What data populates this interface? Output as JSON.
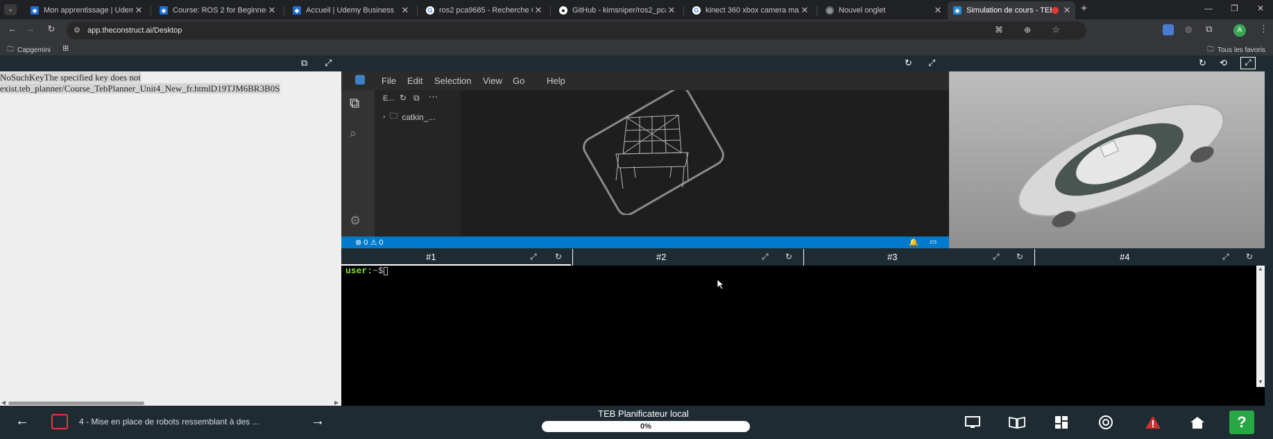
{
  "browser": {
    "tabs": [
      {
        "title": "Mon apprentissage | Udemy Bu",
        "favicon": "udemy"
      },
      {
        "title": "Course: ROS 2 for Beginners Le",
        "favicon": "udemy"
      },
      {
        "title": "Accueil | Udemy Business",
        "favicon": "udemy"
      },
      {
        "title": "ros2 pca9685 - Recherche Goo",
        "favicon": "google"
      },
      {
        "title": "GitHub - kimsniper/ros2_pca96",
        "favicon": "github"
      },
      {
        "title": "kinect 360 xbox camera maroc",
        "favicon": "google"
      },
      {
        "title": "Nouvel onglet",
        "favicon": "chrome"
      },
      {
        "title": "Simulation de cours - TEB P",
        "favicon": "construct",
        "active": true
      }
    ],
    "new_tab_symbol": "+",
    "url": "app.theconstruct.ai/Desktop",
    "bookmarks": [
      {
        "label": "Capgemini"
      }
    ],
    "all_bookmarks_label": "Tous les favoris",
    "profile_initial": "A"
  },
  "left_pane": {
    "error_line1_highlight": "NoSuchKeyThe specified key does not",
    "error_line2_highlight": "exist.teb_planner/Course_TebPlanner_Unit4_New_fr.htmlD19TJM6BR3B0S"
  },
  "vscode": {
    "menu": [
      "File",
      "Edit",
      "Selection",
      "View",
      "Go",
      "Help"
    ],
    "explorer_title": "E...",
    "folder": "catkin_...",
    "status_errors": "0",
    "status_warnings": "0"
  },
  "terminal": {
    "tabs": [
      "#1",
      "#2",
      "#3",
      "#4"
    ],
    "prompt_user": "user:",
    "prompt_path": "~$"
  },
  "bottom": {
    "lesson_title": "4 - Mise en place de robots ressemblant à des ...",
    "course_title": "TEB Planificateur local",
    "progress": "0%",
    "help_symbol": "?"
  },
  "colors": {
    "vscode_status": "#007acc",
    "terminal_prompt": "#8ae234",
    "help_button": "#28a745",
    "warning_icon": "#d32f2f",
    "stop_button": "#e53935"
  }
}
